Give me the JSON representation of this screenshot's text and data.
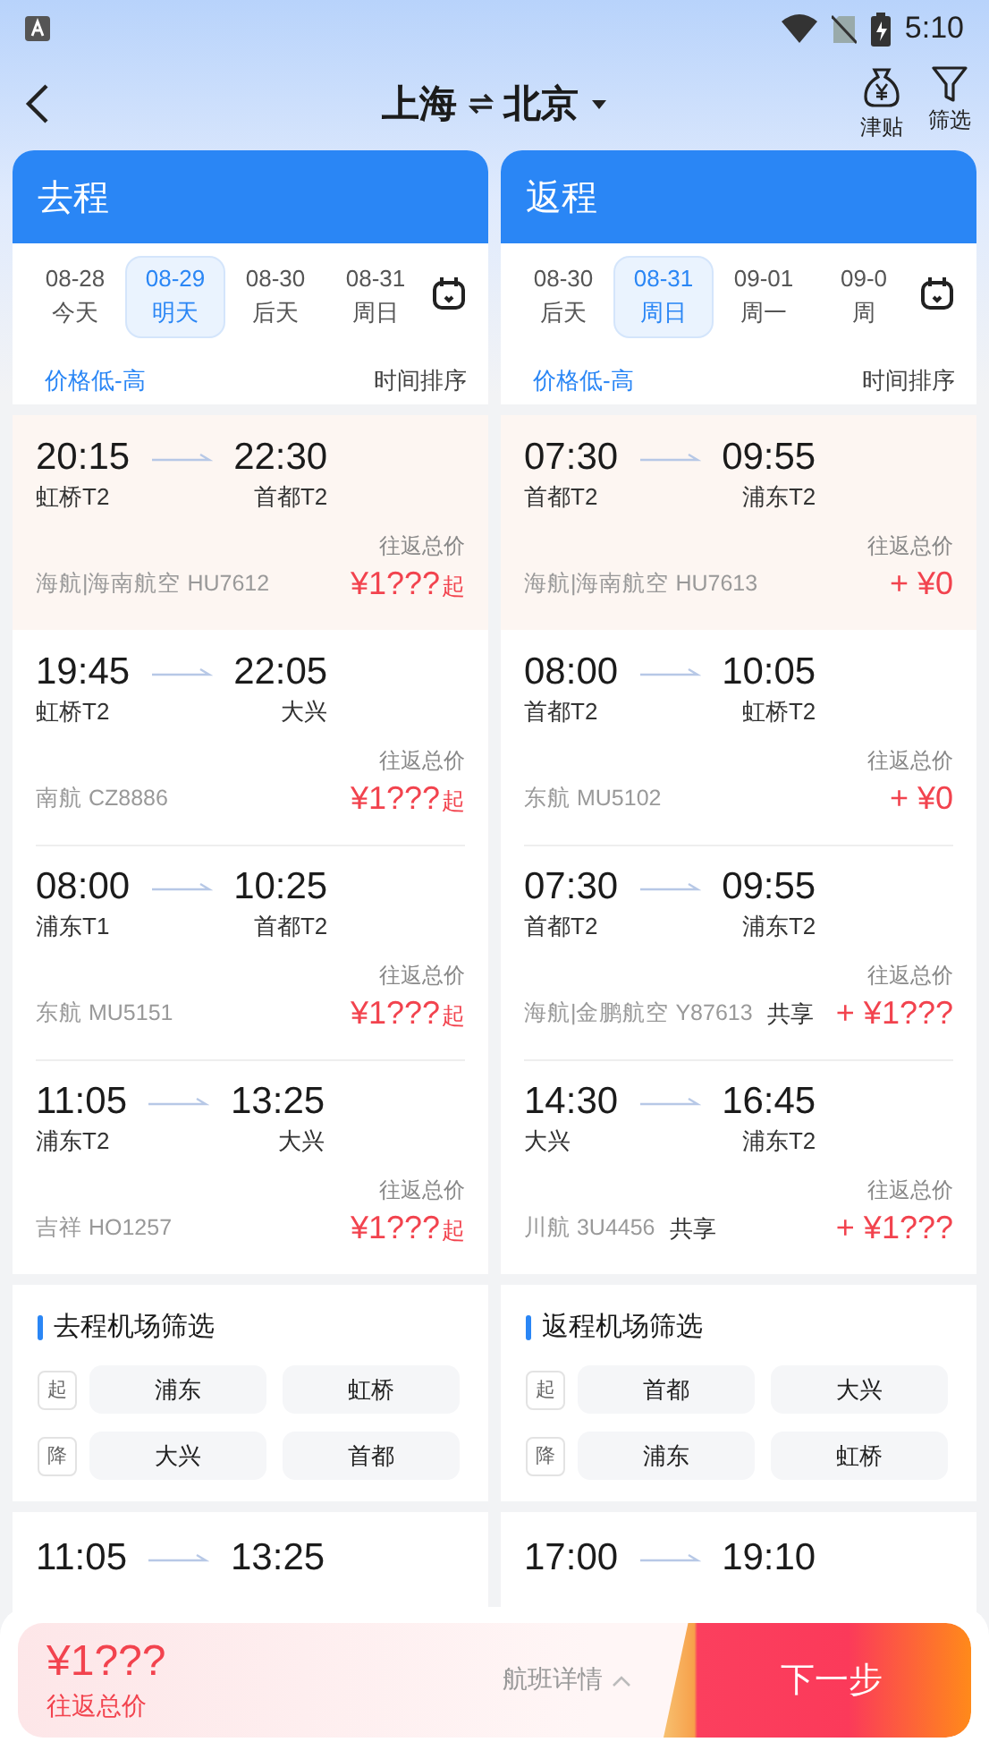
{
  "status_bar": {
    "time": "5:10"
  },
  "nav": {
    "from": "上海",
    "to": "北京",
    "actions": [
      {
        "kind": "allowance",
        "label": "津贴"
      },
      {
        "kind": "filter",
        "label": "筛选"
      }
    ]
  },
  "columns": [
    {
      "title": "去程",
      "dates": [
        {
          "date": "08-28",
          "day": "今天",
          "selected": false
        },
        {
          "date": "08-29",
          "day": "明天",
          "selected": true
        },
        {
          "date": "08-30",
          "day": "后天",
          "selected": false
        },
        {
          "date": "08-31",
          "day": "周日",
          "selected": false
        }
      ],
      "sorts": [
        {
          "label": "价格低-高",
          "selected": true
        },
        {
          "label": "时间排序",
          "selected": false
        }
      ],
      "flights": [
        {
          "dep_time": "20:15",
          "arr_time": "22:30",
          "dep_airport": "虹桥T2",
          "arr_airport": "首都T2",
          "price_label": "往返总价",
          "airline": "海航|海南航空 HU7612",
          "price": "¥1???",
          "price_suffix": "起",
          "highlighted": true
        },
        {
          "dep_time": "19:45",
          "arr_time": "22:05",
          "dep_airport": "虹桥T2",
          "arr_airport": "大兴",
          "price_label": "往返总价",
          "airline": "南航 CZ8886",
          "price": "¥1???",
          "price_suffix": "起",
          "highlighted": false
        },
        {
          "dep_time": "08:00",
          "arr_time": "10:25",
          "dep_airport": "浦东T1",
          "arr_airport": "首都T2",
          "price_label": "往返总价",
          "airline": "东航 MU5151",
          "price": "¥1???",
          "price_suffix": "起",
          "highlighted": false
        },
        {
          "dep_time": "11:05",
          "arr_time": "13:25",
          "dep_airport": "浦东T2",
          "arr_airport": "大兴",
          "price_label": "往返总价",
          "airline": "吉祥 HO1257",
          "price": "¥1???",
          "price_suffix": "起",
          "highlighted": false
        }
      ],
      "airport_filter": {
        "title": "去程机场筛选",
        "rows": [
          {
            "tag": "起",
            "options": [
              "浦东",
              "虹桥"
            ]
          },
          {
            "tag": "降",
            "options": [
              "大兴",
              "首都"
            ]
          }
        ]
      },
      "partial_flight": {
        "dep_time": "11:05",
        "arr_time": "13:25"
      }
    },
    {
      "title": "返程",
      "dates": [
        {
          "date": "08-30",
          "day": "后天",
          "selected": false
        },
        {
          "date": "08-31",
          "day": "周日",
          "selected": true
        },
        {
          "date": "09-01",
          "day": "周一",
          "selected": false
        },
        {
          "date": "09-0",
          "day": "周",
          "selected": false
        }
      ],
      "sorts": [
        {
          "label": "价格低-高",
          "selected": true
        },
        {
          "label": "时间排序",
          "selected": false
        }
      ],
      "flights": [
        {
          "dep_time": "07:30",
          "arr_time": "09:55",
          "dep_airport": "首都T2",
          "arr_airport": "浦东T2",
          "price_label": "往返总价",
          "airline": "海航|海南航空 HU7613",
          "price": "+ ¥0",
          "highlighted": true
        },
        {
          "dep_time": "08:00",
          "arr_time": "10:05",
          "dep_airport": "首都T2",
          "arr_airport": "虹桥T2",
          "price_label": "往返总价",
          "airline": "东航 MU5102",
          "price": "+ ¥0",
          "highlighted": false
        },
        {
          "dep_time": "07:30",
          "arr_time": "09:55",
          "dep_airport": "首都T2",
          "arr_airport": "浦东T2",
          "price_label": "往返总价",
          "airline": "海航|金鹏航空 Y87613",
          "shared": "共享",
          "price": "+ ¥1???",
          "highlighted": false
        },
        {
          "dep_time": "14:30",
          "arr_time": "16:45",
          "dep_airport": "大兴",
          "arr_airport": "浦东T2",
          "price_label": "往返总价",
          "airline": "川航 3U4456",
          "shared": "共享",
          "price": "+ ¥1???",
          "highlighted": false
        }
      ],
      "airport_filter": {
        "title": "返程机场筛选",
        "rows": [
          {
            "tag": "起",
            "options": [
              "首都",
              "大兴"
            ]
          },
          {
            "tag": "降",
            "options": [
              "浦东",
              "虹桥"
            ]
          }
        ]
      },
      "partial_flight": {
        "dep_time": "17:00",
        "arr_time": "19:10"
      }
    }
  ],
  "bottom_bar": {
    "price": "¥1???",
    "price_label": "往返总价",
    "details": "航班详情",
    "next": "下一步"
  }
}
